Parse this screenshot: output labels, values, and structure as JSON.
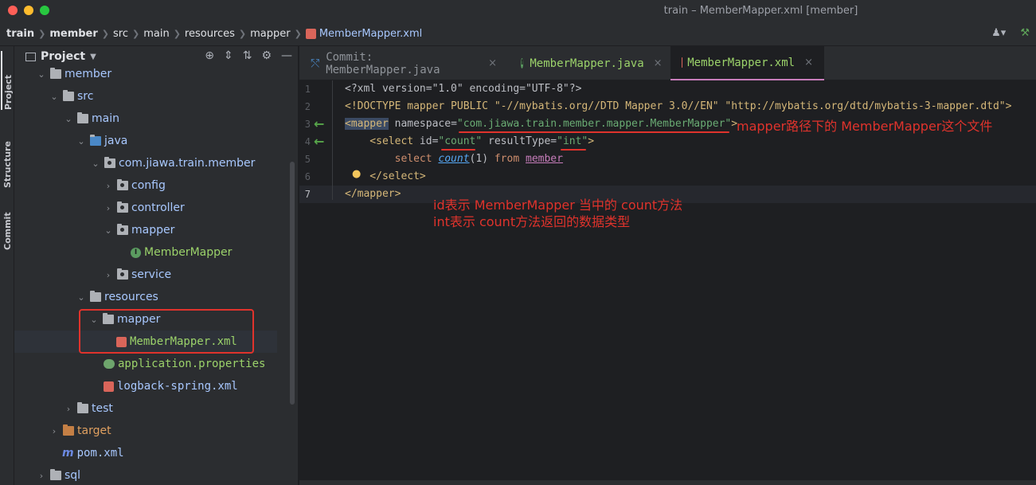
{
  "window": {
    "title": "train – MemberMapper.xml [member]"
  },
  "breadcrumb": [
    "train",
    "member",
    "src",
    "main",
    "resources",
    "mapper",
    "MemberMapper.xml"
  ],
  "toolstrip": {
    "project": "Project",
    "structure": "Structure",
    "commit": "Commit"
  },
  "project_panel": {
    "title": "Project",
    "tree": [
      {
        "label": "member",
        "depth": 1,
        "expanded": true,
        "icon": "module-folder-icon"
      },
      {
        "label": "src",
        "depth": 2,
        "expanded": true,
        "icon": "folder-icon"
      },
      {
        "label": "main",
        "depth": 3,
        "expanded": true,
        "icon": "folder-icon"
      },
      {
        "label": "java",
        "depth": 4,
        "expanded": true,
        "icon": "source-folder-icon"
      },
      {
        "label": "com.jiawa.train.member",
        "depth": 5,
        "expanded": true,
        "icon": "package-icon"
      },
      {
        "label": "config",
        "depth": 6,
        "expanded": false,
        "icon": "package-icon"
      },
      {
        "label": "controller",
        "depth": 6,
        "expanded": false,
        "icon": "package-icon"
      },
      {
        "label": "mapper",
        "depth": 6,
        "expanded": true,
        "icon": "package-icon"
      },
      {
        "label": "MemberMapper",
        "depth": 7,
        "icon": "interface-icon"
      },
      {
        "label": "service",
        "depth": 6,
        "expanded": false,
        "icon": "package-icon"
      },
      {
        "label": "resources",
        "depth": 4,
        "expanded": true,
        "icon": "resources-folder-icon"
      },
      {
        "label": "mapper",
        "depth": 5,
        "expanded": true,
        "icon": "folder-icon"
      },
      {
        "label": "MemberMapper.xml",
        "depth": 6,
        "icon": "xml-file-icon",
        "selected": true
      },
      {
        "label": "application.properties",
        "depth": 5,
        "icon": "properties-file-icon"
      },
      {
        "label": "logback-spring.xml",
        "depth": 5,
        "icon": "xml-file-icon"
      },
      {
        "label": "test",
        "depth": 3,
        "expanded": false,
        "icon": "folder-icon"
      },
      {
        "label": "target",
        "depth": 2,
        "expanded": false,
        "icon": "excluded-folder-icon"
      },
      {
        "label": "pom.xml",
        "depth": 2,
        "icon": "maven-icon"
      },
      {
        "label": "sql",
        "depth": 1,
        "expanded": false,
        "icon": "folder-icon"
      }
    ]
  },
  "tabs": [
    {
      "label": "Commit: MemberMapper.java",
      "close": "×"
    },
    {
      "label": "MemberMapper.java",
      "close": "×"
    },
    {
      "label": "MemberMapper.xml",
      "close": "×"
    }
  ],
  "editor": {
    "line_numbers": [
      "1",
      "2",
      "3",
      "4",
      "5",
      "6",
      "7"
    ],
    "lines": {
      "l1": "<?xml version=\"1.0\" encoding=\"UTF-8\"?>",
      "l2": "<!DOCTYPE mapper PUBLIC \"-//mybatis.org//DTD Mapper 3.0//EN\" \"http://mybatis.org/dtd/mybatis-3-mapper.dtd\">",
      "l3_open": "<mapper",
      "l3_attr": " namespace=",
      "l3_val": "\"com.jiawa.train.member.mapper.MemberMapper\"",
      "l3_close": ">",
      "l4_open": "    <select",
      "l4_attr1": " id=",
      "l4_val1": "\"count\"",
      "l4_attr2": " resultType=",
      "l4_val2": "\"int\"",
      "l4_close": ">",
      "l5_select": "        select ",
      "l5_count": "count",
      "l5_args": "(1) ",
      "l5_from": "from ",
      "l5_member": "member",
      "l6": "    </select>",
      "l7": "</mapper>"
    }
  },
  "annotations": {
    "namespace_note": "mapper路径下的 MemberMapper这个文件",
    "id_note": "id表示 MemberMapper 当中的 count方法",
    "int_note": "int表示 count方法返回的数据类型"
  }
}
